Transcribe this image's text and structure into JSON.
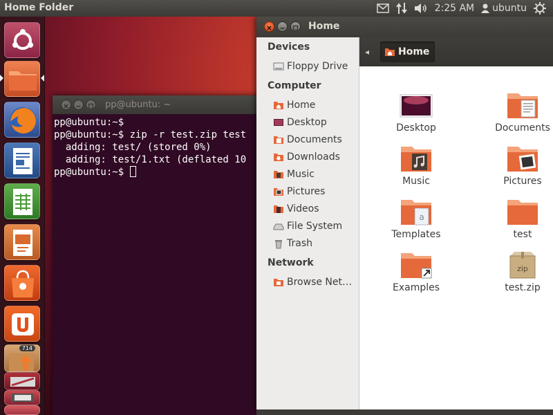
{
  "panel": {
    "app_title": "Home Folder",
    "clock": "2:25 AM",
    "user": "ubuntu",
    "icons": [
      "mail-icon",
      "network-icon",
      "volume-icon",
      "user-icon",
      "power-icon"
    ]
  },
  "launcher": {
    "items": [
      "dash",
      "home-folder",
      "firefox",
      "libreoffice-writer",
      "libreoffice-calc",
      "libreoffice-impress",
      "ubuntu-software-center",
      "ubuntu-one",
      "update-manager",
      "workspace-switcher",
      "trash"
    ],
    "update_badge": "714"
  },
  "terminal": {
    "title": "pp@ubuntu: ~",
    "lines": [
      "pp@ubuntu:~$",
      "pp@ubuntu:~$ zip -r test.zip test",
      "  adding: test/ (stored 0%)",
      "  adding: test/1.txt (deflated 10",
      "pp@ubuntu:~$ "
    ]
  },
  "filemanager": {
    "title": "Home",
    "breadcrumb": "Home",
    "sidebar": {
      "devices_heading": "Devices",
      "devices": [
        "Floppy Drive"
      ],
      "computer_heading": "Computer",
      "computer": [
        "Home",
        "Desktop",
        "Documents",
        "Downloads",
        "Music",
        "Pictures",
        "Videos",
        "File System",
        "Trash"
      ],
      "network_heading": "Network",
      "network": [
        "Browse Net…"
      ]
    },
    "files": [
      "Desktop",
      "Documents",
      "Music",
      "Pictures",
      "Templates",
      "test",
      "Examples",
      "test.zip"
    ],
    "zip_label": "zip"
  },
  "colors": {
    "terminal_bg": "#300a24",
    "folder_orange": "#e5693a",
    "close_button": "#e9541e",
    "panel_bg": "#3c3b37"
  }
}
